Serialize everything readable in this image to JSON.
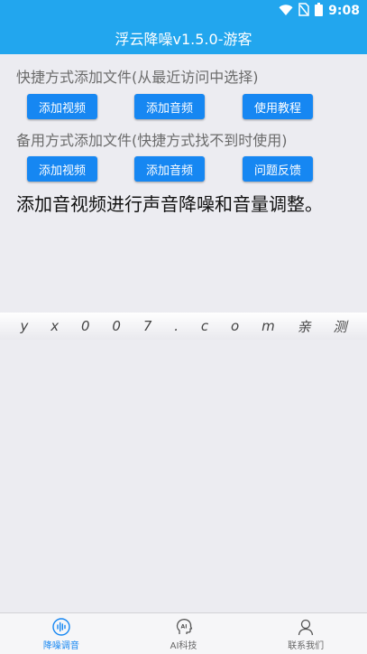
{
  "status_bar": {
    "time": "9:08"
  },
  "title": "浮云降噪v1.5.0-游客",
  "quick_section": {
    "label": "快捷方式添加文件(从最近访问中选择)",
    "buttons": [
      "添加视频",
      "添加音频",
      "使用教程"
    ]
  },
  "backup_section": {
    "label": "备用方式添加文件(快捷方式找不到时使用)",
    "buttons": [
      "添加视频",
      "添加音频",
      "问题反馈"
    ]
  },
  "description": "添加音视频进行声音降噪和音量调整。",
  "watermark": [
    "y",
    "x",
    "0",
    "0",
    "7",
    ".",
    "c",
    "o",
    "m",
    "亲",
    "测"
  ],
  "bottom_nav": {
    "items": [
      {
        "label": "降噪调音",
        "icon": "waveform-icon",
        "active": true
      },
      {
        "label": "AI科技",
        "icon": "ai-head-icon",
        "active": false
      },
      {
        "label": "联系我们",
        "icon": "person-icon",
        "active": false
      }
    ]
  },
  "colors": {
    "accent": "#22a6ee",
    "button": "#1687f2",
    "background": "#ececf1"
  }
}
